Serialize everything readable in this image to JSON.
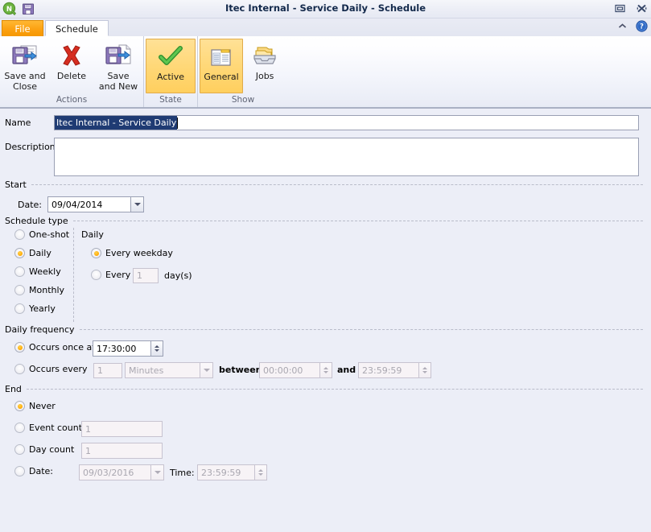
{
  "window": {
    "title": "Itec Internal - Service Daily - Schedule",
    "logo_icon": "q-logo-icon",
    "save_icon": "save-icon",
    "restore_button": "restore-window-button",
    "close_button": "close-window-button",
    "collapse_ribbon_button": "collapse-ribbon-icon",
    "help_button": "help-icon"
  },
  "tabs": {
    "file_label": "File",
    "schedule_label": "Schedule"
  },
  "ribbon": {
    "groups": [
      {
        "label": "Actions",
        "buttons": [
          {
            "caption_line1": "Save and",
            "caption_line2": "Close",
            "icon": "save-and-close-icon",
            "selected": false
          },
          {
            "caption_line1": "Delete",
            "caption_line2": "",
            "icon": "delete-icon",
            "selected": false
          },
          {
            "caption_line1": "Save",
            "caption_line2": "and New",
            "icon": "save-and-new-icon",
            "selected": false
          }
        ]
      },
      {
        "label": "State",
        "buttons": [
          {
            "caption_line1": "Active",
            "caption_line2": "",
            "icon": "checkmark-icon",
            "selected": true
          }
        ]
      },
      {
        "label": "Show",
        "buttons": [
          {
            "caption_line1": "General",
            "caption_line2": "",
            "icon": "general-page-icon",
            "selected": true
          },
          {
            "caption_line1": "Jobs",
            "caption_line2": "",
            "icon": "jobs-tray-icon",
            "selected": false
          }
        ]
      }
    ]
  },
  "form": {
    "name_label": "Name",
    "name_value": "Itec Internal - Service Daily",
    "description_label": "Description",
    "description_value": "",
    "start": {
      "group_label": "Start",
      "date_label": "Date:",
      "date_value": "09/04/2014"
    },
    "schedule_type": {
      "group_label": "Schedule type",
      "options": [
        {
          "label": "One-shot",
          "selected": false
        },
        {
          "label": "Daily",
          "selected": true
        },
        {
          "label": "Weekly",
          "selected": false
        },
        {
          "label": "Monthly",
          "selected": false
        },
        {
          "label": "Yearly",
          "selected": false
        }
      ],
      "panel_title": "Daily",
      "daily_options": [
        {
          "label": "Every weekday",
          "selected": true
        },
        {
          "label": "Every",
          "selected": false
        }
      ],
      "every_days_value": "1",
      "every_days_suffix": "day(s)"
    },
    "daily_frequency": {
      "group_label": "Daily frequency",
      "occurs_once_label": "Occurs once at",
      "occurs_once_selected": true,
      "occurs_once_value": "17:30:00",
      "occurs_every_label": "Occurs every",
      "occurs_every_selected": false,
      "occurs_every_value": "1",
      "occurs_every_unit": "Minutes",
      "between_label": "between",
      "between_value": "00:00:00",
      "and_label": "and",
      "and_value": "23:59:59"
    },
    "end": {
      "group_label": "End",
      "never_label": "Never",
      "never_selected": true,
      "event_count_label": "Event count",
      "event_count_selected": false,
      "event_count_value": "1",
      "day_count_label": "Day count",
      "day_count_selected": false,
      "day_count_value": "1",
      "date_label": "Date:",
      "date_selected": false,
      "date_value": "09/03/2016",
      "time_label": "Time:",
      "time_value": "23:59:59"
    }
  },
  "colors": {
    "accent_orange": "#f59700",
    "selected_fill": "#ffd878",
    "selection_blue": "#1f3b73",
    "body_bg": "#eceef7"
  }
}
